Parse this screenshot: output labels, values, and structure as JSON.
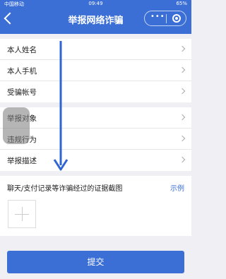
{
  "status_bar": {
    "carrier": "中国移动",
    "time": "09:49",
    "battery": "65%"
  },
  "header": {
    "title": "举报网络诈骗",
    "capsule_dots": "•••"
  },
  "group1": [
    {
      "label": "本人姓名"
    },
    {
      "label": "本人手机"
    },
    {
      "label": "受骗帐号"
    }
  ],
  "group2": [
    {
      "label": "举报对象"
    },
    {
      "label": "违规行为"
    },
    {
      "label": "举报描述"
    }
  ],
  "evidence": {
    "label": "聊天/支付记录等诈骗经过的证据截图",
    "example_link": "示例"
  },
  "submit_button": "提交",
  "colors": {
    "accent": "#3b6fd6",
    "background": "#efeff4"
  }
}
